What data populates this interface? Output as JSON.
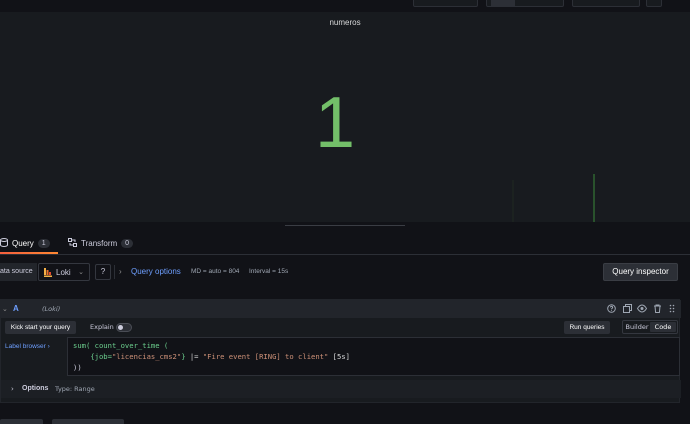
{
  "panel": {
    "title": "numeros",
    "stat_value": "1",
    "stat_color": "#73bf69"
  },
  "tabs": [
    {
      "label": "Query",
      "count": "1",
      "active": true
    },
    {
      "label": "Transform",
      "count": "0",
      "active": false
    }
  ],
  "datasource": {
    "label": "ata source",
    "selected": "Loki",
    "query_options_label": "Query options",
    "md": "MD = auto = 804",
    "interval": "Interval = 15s",
    "inspector_label": "Query inspector"
  },
  "query_row": {
    "ref_id": "A",
    "datasource_note": "(Loki)",
    "kickstart_label": "Kick start your query",
    "explain_label": "Explain",
    "explain_on": false,
    "run_label": "Run queries",
    "modes": [
      "Builder",
      "Code"
    ],
    "active_mode": "Code",
    "label_browser": "Label browser",
    "code": {
      "line1_fn": "sum( count_over_time (",
      "line2_selector_key": "{job=",
      "line2_selector_val": "\"licencias_cms2\"",
      "line2_selector_end": "}",
      "line2_pipe": "|=",
      "line2_filter": "\"Fire event [RING] to client\"",
      "line2_range": "[5s]",
      "line3": "))"
    },
    "options_label": "Options",
    "options_type": "Type: Range"
  },
  "colors": {
    "accent": "#6e9fff",
    "tab_underline": "#f55f3e",
    "background": "#111217",
    "panel": "#181b1f"
  }
}
